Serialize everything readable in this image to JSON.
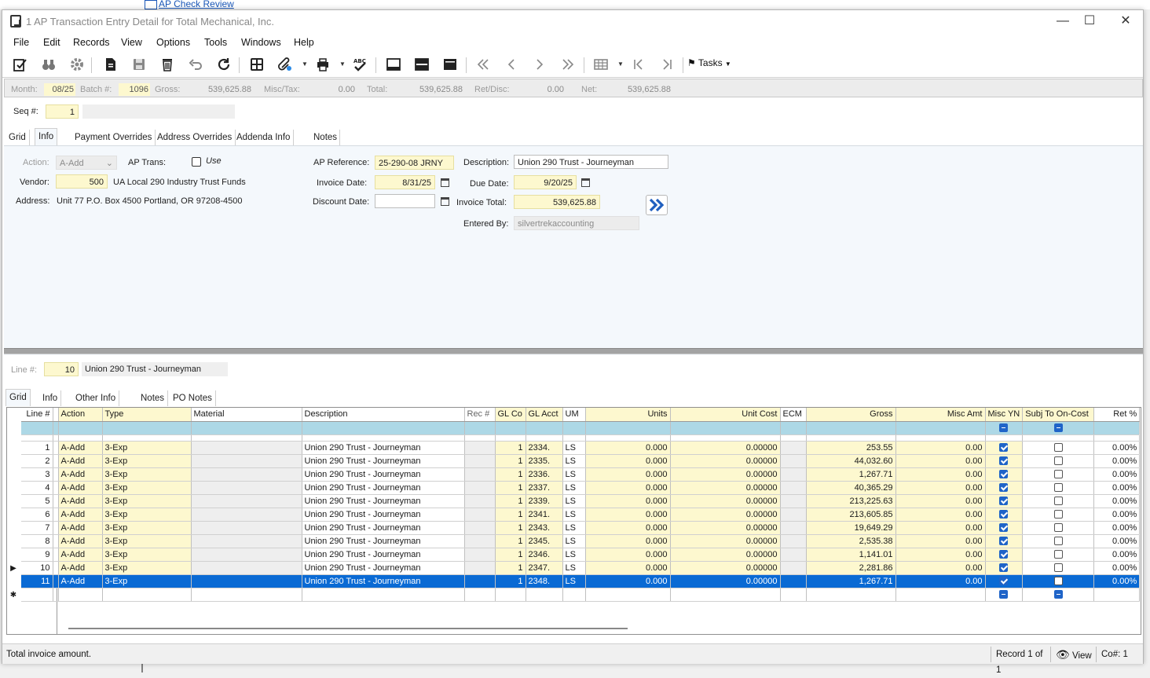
{
  "background": {
    "link_text": "AP Check Review"
  },
  "window": {
    "title": "1 AP Transaction Entry Detail for Total Mechanical, Inc."
  },
  "menu": [
    "File",
    "Edit",
    "Records",
    "View",
    "Options",
    "Tools",
    "Windows",
    "Help"
  ],
  "toolbar": {
    "icons": [
      "edit-check-icon",
      "binoculars-icon",
      "settings-gear-icon",
      "new-document-icon",
      "save-icon",
      "delete-trash-icon",
      "undo-icon",
      "refresh-icon",
      "calculator-grid-icon",
      "attachment-link-icon",
      "print-icon",
      "spellcheck-icon",
      "layout-single-icon",
      "layout-split-icon",
      "layout-full-icon",
      "first-record-icon",
      "previous-record-icon",
      "next-record-icon",
      "last-record-icon",
      "grid-view-icon",
      "go-first-icon",
      "go-last-icon",
      "flag-icon"
    ],
    "tasks_label": "Tasks"
  },
  "header": {
    "month_label": "Month:",
    "month": "08/25",
    "batch_label": "Batch #:",
    "batch": "1096",
    "gross_label": "Gross:",
    "gross": "539,625.88",
    "misc_label": "Misc/Tax:",
    "misc": "0.00",
    "total_label": "Total:",
    "total": "539,625.88",
    "ret_label": "Ret/Disc:",
    "ret": "0.00",
    "net_label": "Net:",
    "net": "539,625.88"
  },
  "seq": {
    "label": "Seq #:",
    "value": "1"
  },
  "top_tabs": [
    "Grid",
    "Info",
    "Payment Overrides",
    "Address Overrides",
    "Addenda Info",
    "Notes"
  ],
  "info": {
    "action_label": "Action:",
    "action": "A-Add",
    "ap_trans_label": "AP Trans:",
    "use_label": "Use",
    "vendor_label": "Vendor:",
    "vendor_num": "500",
    "vendor_name": "UA Local 290 Industry Trust Funds",
    "address_label": "Address:",
    "address": "Unit 77 P.O. Box 4500  Portland, OR  97208-4500",
    "ap_ref_label": "AP Reference:",
    "ap_ref": "25-290-08 JRNY",
    "invoice_date_label": "Invoice Date:",
    "invoice_date": "8/31/25",
    "discount_date_label": "Discount Date:",
    "discount_date": "",
    "description_label": "Description:",
    "description": "Union 290 Trust - Journeyman",
    "due_date_label": "Due Date:",
    "due_date": "9/20/25",
    "invoice_total_label": "Invoice Total:",
    "invoice_total": "539,625.88",
    "entered_by_label": "Entered By:",
    "entered_by": "silvertrekaccounting"
  },
  "line": {
    "label": "Line #:",
    "value": "10",
    "description": "Union 290 Trust - Journeyman"
  },
  "bottom_tabs": [
    "Grid",
    "Info",
    "Other Info",
    "Notes",
    "PO Notes"
  ],
  "grid": {
    "columns": [
      "Line #",
      "Action",
      "Type",
      "Material",
      "Description",
      "Rec #",
      "GL Co",
      "GL Acct",
      "UM",
      "Units",
      "Unit Cost",
      "ECM",
      "Gross",
      "Misc Amt",
      "Misc YN",
      "Subj To On-Cost",
      "Ret %"
    ],
    "rows": [
      {
        "line": "1",
        "action": "A-Add",
        "type": "3-Exp",
        "description": "Union 290 Trust - Journeyman",
        "glco": "1",
        "glacct": "2334.",
        "um": "LS",
        "units": "0.000",
        "unit_cost": "0.00000",
        "gross": "253.55",
        "misc": "0.00",
        "misc_yn": true,
        "subj": false,
        "ret": "0.00%"
      },
      {
        "line": "2",
        "action": "A-Add",
        "type": "3-Exp",
        "description": "Union 290 Trust - Journeyman",
        "glco": "1",
        "glacct": "2335.",
        "um": "LS",
        "units": "0.000",
        "unit_cost": "0.00000",
        "gross": "44,032.60",
        "misc": "0.00",
        "misc_yn": true,
        "subj": false,
        "ret": "0.00%"
      },
      {
        "line": "3",
        "action": "A-Add",
        "type": "3-Exp",
        "description": "Union 290 Trust - Journeyman",
        "glco": "1",
        "glacct": "2336.",
        "um": "LS",
        "units": "0.000",
        "unit_cost": "0.00000",
        "gross": "1,267.71",
        "misc": "0.00",
        "misc_yn": true,
        "subj": false,
        "ret": "0.00%"
      },
      {
        "line": "4",
        "action": "A-Add",
        "type": "3-Exp",
        "description": "Union 290 Trust - Journeyman",
        "glco": "1",
        "glacct": "2337.",
        "um": "LS",
        "units": "0.000",
        "unit_cost": "0.00000",
        "gross": "40,365.29",
        "misc": "0.00",
        "misc_yn": true,
        "subj": false,
        "ret": "0.00%"
      },
      {
        "line": "5",
        "action": "A-Add",
        "type": "3-Exp",
        "description": "Union 290 Trust - Journeyman",
        "glco": "1",
        "glacct": "2339.",
        "um": "LS",
        "units": "0.000",
        "unit_cost": "0.00000",
        "gross": "213,225.63",
        "misc": "0.00",
        "misc_yn": true,
        "subj": false,
        "ret": "0.00%"
      },
      {
        "line": "6",
        "action": "A-Add",
        "type": "3-Exp",
        "description": "Union 290 Trust - Journeyman",
        "glco": "1",
        "glacct": "2341.",
        "um": "LS",
        "units": "0.000",
        "unit_cost": "0.00000",
        "gross": "213,605.85",
        "misc": "0.00",
        "misc_yn": true,
        "subj": false,
        "ret": "0.00%"
      },
      {
        "line": "7",
        "action": "A-Add",
        "type": "3-Exp",
        "description": "Union 290 Trust - Journeyman",
        "glco": "1",
        "glacct": "2343.",
        "um": "LS",
        "units": "0.000",
        "unit_cost": "0.00000",
        "gross": "19,649.29",
        "misc": "0.00",
        "misc_yn": true,
        "subj": false,
        "ret": "0.00%"
      },
      {
        "line": "8",
        "action": "A-Add",
        "type": "3-Exp",
        "description": "Union 290 Trust - Journeyman",
        "glco": "1",
        "glacct": "2345.",
        "um": "LS",
        "units": "0.000",
        "unit_cost": "0.00000",
        "gross": "2,535.38",
        "misc": "0.00",
        "misc_yn": true,
        "subj": false,
        "ret": "0.00%"
      },
      {
        "line": "9",
        "action": "A-Add",
        "type": "3-Exp",
        "description": "Union 290 Trust - Journeyman",
        "glco": "1",
        "glacct": "2346.",
        "um": "LS",
        "units": "0.000",
        "unit_cost": "0.00000",
        "gross": "1,141.01",
        "misc": "0.00",
        "misc_yn": true,
        "subj": false,
        "ret": "0.00%"
      },
      {
        "line": "10",
        "action": "A-Add",
        "type": "3-Exp",
        "description": "Union 290 Trust - Journeyman",
        "glco": "1",
        "glacct": "2347.",
        "um": "LS",
        "units": "0.000",
        "unit_cost": "0.00000",
        "gross": "2,281.86",
        "misc": "0.00",
        "misc_yn": true,
        "subj": false,
        "ret": "0.00%"
      },
      {
        "line": "11",
        "action": "A-Add",
        "type": "3-Exp",
        "description": "Union 290 Trust - Journeyman",
        "glco": "1",
        "glacct": "2348.",
        "um": "LS",
        "units": "0.000",
        "unit_cost": "0.00000",
        "gross": "1,267.71",
        "misc": "0.00",
        "misc_yn": true,
        "subj": false,
        "ret": "0.00%"
      }
    ],
    "selected_row": "11",
    "current_row": "10"
  },
  "status": {
    "message": "Total invoice amount.",
    "record": "Record 1 of 1",
    "view_label": "View",
    "company": "Co#: 1"
  },
  "colors": {
    "selection": "#0a6ad4",
    "required_field": "#fdf8cf",
    "filter_row": "#add8e6"
  }
}
